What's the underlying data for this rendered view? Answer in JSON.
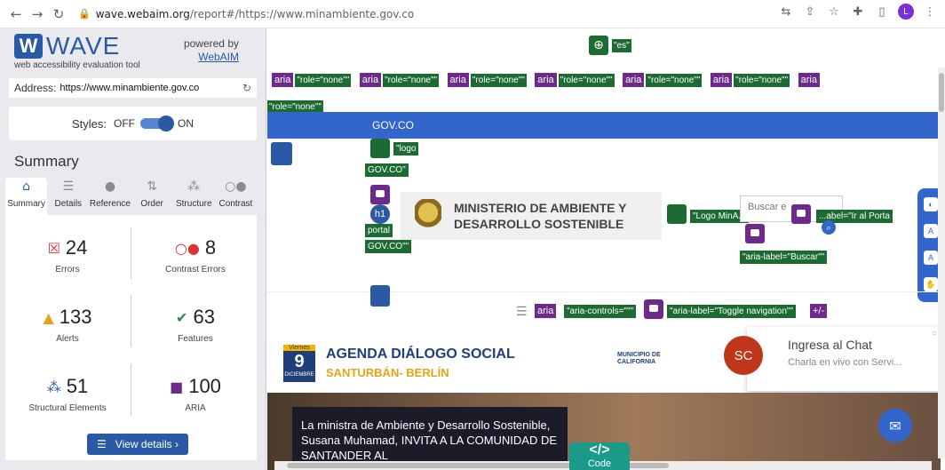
{
  "browser": {
    "url_host": "wave.webaim.org",
    "url_rest": "/report#/https://www.minambiente.gov.co",
    "avatar_letter": "L"
  },
  "wave": {
    "logo_text": "WAVE",
    "tagline": "web accessibility evaluation tool",
    "powered_by": "powered by",
    "webaim_link": "WebAIM",
    "address_label": "Address:",
    "address_value": "https://www.minambiente.gov.co",
    "styles_label": "Styles:",
    "styles_off": "OFF",
    "styles_on": "ON",
    "summary_title": "Summary",
    "tabs": [
      "Summary",
      "Details",
      "Reference",
      "Order",
      "Structure",
      "Contrast"
    ],
    "stats": {
      "errors": {
        "value": "24",
        "label": "Errors"
      },
      "contrast": {
        "value": "8",
        "label": "Contrast Errors"
      },
      "alerts": {
        "value": "133",
        "label": "Alerts"
      },
      "features": {
        "value": "63",
        "label": "Features"
      },
      "structural": {
        "value": "51",
        "label": "Structural Elements"
      },
      "aria": {
        "value": "100",
        "label": "ARIA"
      }
    },
    "view_details": "View details ›"
  },
  "page": {
    "lang_tag": "\"es\"",
    "aria_label": "aria",
    "role_none": "\"role=\"none\"\"",
    "gov_co": "GOV.CO",
    "logo_tag": "\"logo",
    "logo_tag2": "GOV.CO\"",
    "h1": "h1",
    "ministry_line1": "MINISTERIO DE AMBIENTE Y",
    "ministry_line2": "DESARROLLO SOSTENIBLE",
    "logo_min": "\"Logo MinA...",
    "search_placeholder": "Buscar e",
    "aria_buscar": "\"aria-label=\"Buscar\"\"",
    "ir_portal": "...abel=\"Ir al Porta",
    "portal_text": "portal",
    "portal_gov": "GOV.CO\"\"",
    "aria_controls": "\"aria-controls=\"\"\"",
    "toggle_nav": "\"aria-label=\"Toggle navigation\"\"",
    "plus_minus": "+/-",
    "date_weekday": "Viernes",
    "date_day": "9",
    "date_month": "DICIEMBRE",
    "agenda_title": "AGENDA DIÁLOGO SOCIAL",
    "agenda_sub": "SANTURBÁN- BERLÍN",
    "municipio": "MUNICIPIO DE CALIFORNIA",
    "chat_avatar": "SC",
    "chat_title": "Ingresa al Chat",
    "chat_sub": "Charla en vivo con Servi...",
    "hero_text": "La ministra de Ambiente y Desarrollo Sostenible, Susana Muhamad, INVITA A LA COMUNIDAD DE SANTANDER AL",
    "code_label": "Code"
  }
}
